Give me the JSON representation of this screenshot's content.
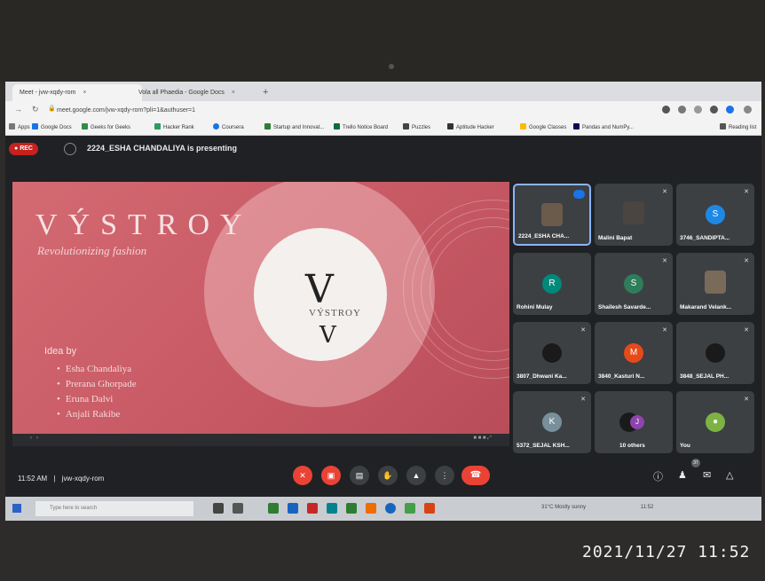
{
  "browser": {
    "tabs": [
      {
        "label": "Meet - jvw-xqdy-rom",
        "close": "×"
      },
      {
        "label": "Vola all Phaedia - Google Docs",
        "close": "×"
      }
    ],
    "new_tab": "+",
    "url": "meet.google.com/jvw-xqdy-rom?pli=1&authuser=1",
    "bookmarks": [
      "Apps",
      "Google Docs",
      "Geeks for Geeks",
      "Hacker Rank",
      "Coursera",
      "Startup and Innovat...",
      "Trello Notice Board",
      "Puzzles",
      "Aptitude Hacker",
      "Google Classes",
      "Pandas and NumPy..."
    ],
    "reading_list": "Reading list"
  },
  "meet": {
    "rec_label": "REC",
    "presenting_text": "2224_ESHA CHANDALIYA is presenting",
    "meeting_code": "jvw-xqdy-rom",
    "time": "11:52 AM",
    "separator": "|",
    "slide": {
      "brand": "VÝSTROY",
      "tagline": "Revolutionizing fashion",
      "logo_letter": "V",
      "logo_word": "VÝSTROY",
      "logo_letter_small": "V",
      "idea_heading": "Idea by",
      "names": [
        "Esha Chandaliya",
        "Prerana Ghorpade",
        "Eruna Dalvi",
        "Anjali Rakibe"
      ]
    },
    "participants": [
      {
        "name": "2224_ESHA CHA...",
        "type": "photo",
        "speaking": true
      },
      {
        "name": "Malini Bapat",
        "type": "photo"
      },
      {
        "name": "3746_SANDIPTA...",
        "initial": "S",
        "color": "#1e88e5"
      },
      {
        "name": "Rohini Mulay",
        "initial": "R",
        "color": "#00897b"
      },
      {
        "name": "Shailesh Savarde...",
        "initial": "S",
        "color": "#2e7d5b"
      },
      {
        "name": "Makarand Velank...",
        "type": "photo"
      },
      {
        "name": "3807_Dhwani Ka...",
        "type": "dark"
      },
      {
        "name": "3840_Kasturi N...",
        "initial": "M",
        "color": "#e64a19"
      },
      {
        "name": "3848_SEJAL PH...",
        "type": "dark"
      },
      {
        "name": "5372_SEJAL KSH...",
        "initial": "K",
        "color": "#78909c"
      },
      {
        "name": "10 others",
        "type": "others",
        "initial": "J"
      },
      {
        "name": "You",
        "type": "you"
      }
    ],
    "participant_count": "37"
  },
  "taskbar": {
    "search_placeholder": "Type here to search",
    "weather": "31°C  Mostly sunny",
    "clock": "11:52"
  },
  "photo_stamp": "2021/11/27  11:52",
  "colors": {
    "accent": "#1a73e8",
    "rec": "#c5221f",
    "hangup": "#ea4335",
    "slide": "#c95b66"
  }
}
